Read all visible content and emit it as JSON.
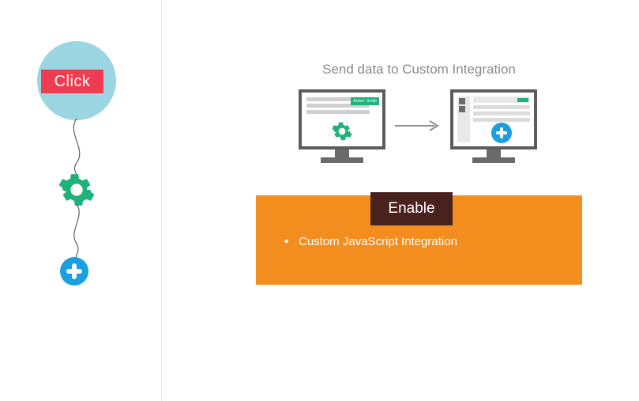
{
  "left": {
    "click_label": "Click"
  },
  "right": {
    "title": "Send data to Custom Integration",
    "source_badge": "Action: Script",
    "enable_label": "Enable",
    "features": [
      "Custom JavaScript Integration"
    ]
  },
  "colors": {
    "accent_teal": "#1fb37b",
    "accent_blue": "#1a9fe0",
    "accent_orange": "#f38e1e",
    "accent_red": "#ee3d52",
    "circle_blue": "#9cd6e3",
    "dark_brown": "#4a221d"
  }
}
